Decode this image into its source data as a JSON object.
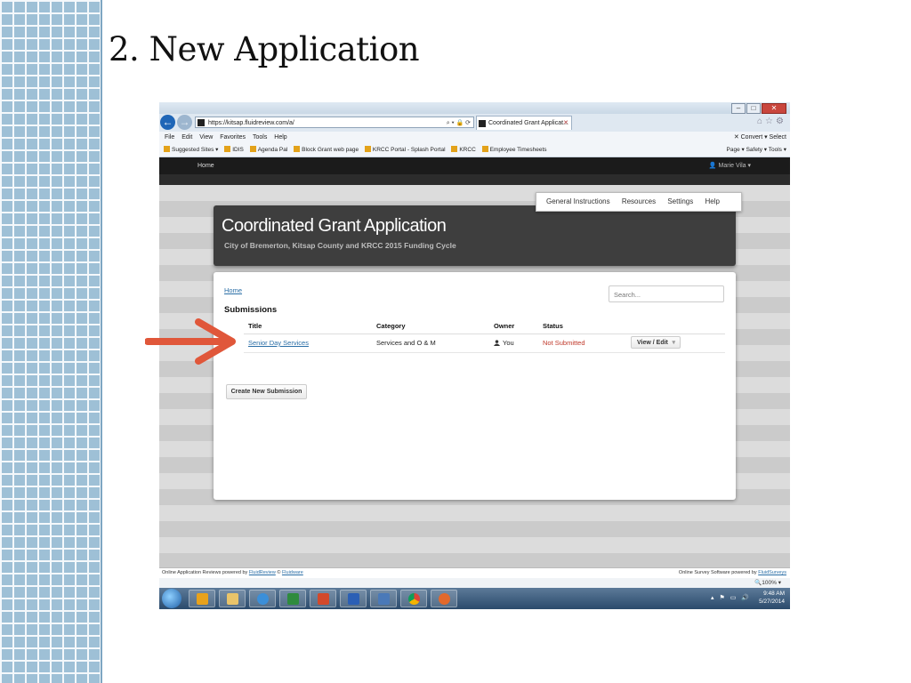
{
  "slide": {
    "title": "2. New Application"
  },
  "browser": {
    "url": "https://kitsap.fluidreview.com/a/",
    "tab_title": "Coordinated Grant Applicat...",
    "menu": [
      "File",
      "Edit",
      "View",
      "Favorites",
      "Tools",
      "Help"
    ],
    "menu_right": "✕  Convert ▾  Select",
    "favorites": [
      "Suggested Sites ▾",
      "IDIS",
      "Agenda Pal",
      "Block Grant web page",
      "KRCC Portal - Splash Portal",
      "KRCC",
      "Employee Timesheets"
    ],
    "favorites_right": "Page ▾  Safety ▾  Tools ▾",
    "zoom": "100%"
  },
  "site": {
    "nav_home": "Home",
    "user": "Marie Vila ▾",
    "menu": [
      "General Instructions",
      "Resources",
      "Settings",
      "Help"
    ],
    "app_title": "Coordinated Grant Application",
    "app_subtitle": "City of Bremerton, Kitsap County and KRCC 2015 Funding Cycle",
    "breadcrumb": "Home",
    "search_placeholder": "Search...",
    "section_title": "Submissions",
    "columns": [
      "Title",
      "Category",
      "Owner",
      "Status"
    ],
    "rows": [
      {
        "title": "Senior Day Services",
        "category": "Services and O & M",
        "owner": "You",
        "status": "Not Submitted",
        "action": "View / Edit"
      }
    ],
    "create_button": "Create New Submission",
    "footer_left_prefix": "Online Application Reviews powered by",
    "footer_left_link1": "FluidReview",
    "footer_left_sep": "©",
    "footer_left_link2": "Fluidware",
    "footer_right_prefix": "Online Survey Software powered by",
    "footer_right_link": "FluidSurveys"
  },
  "taskbar": {
    "time": "9:48 AM",
    "date": "5/27/2014"
  },
  "colors": {
    "arrow": "#e0573a",
    "accent_link": "#2a6ea6",
    "status_red": "#c0392b"
  }
}
